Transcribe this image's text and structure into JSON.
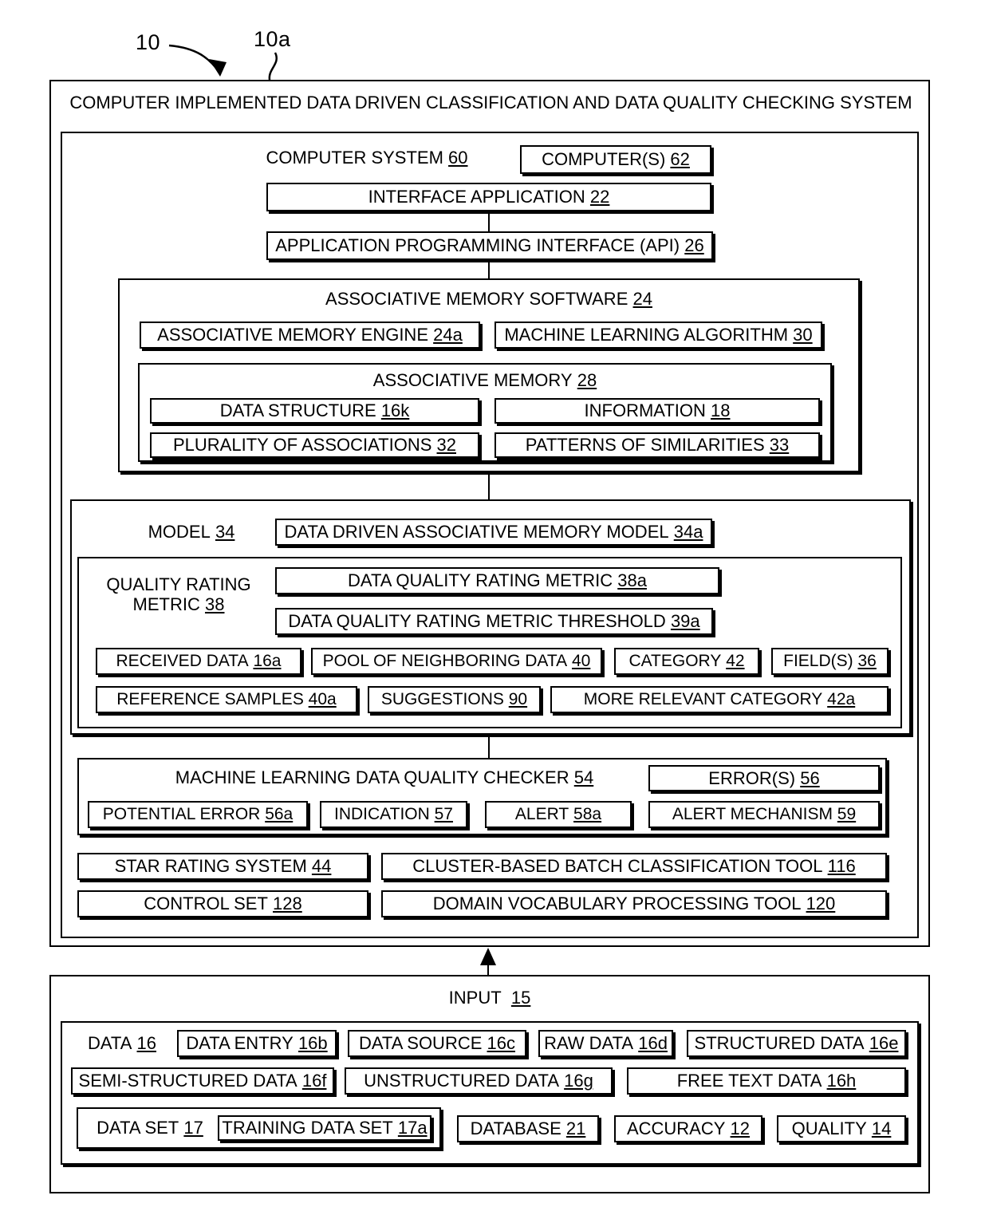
{
  "figure": {
    "lead_labels": [
      {
        "id": "lead-10",
        "text": "10"
      },
      {
        "id": "lead-10a",
        "text": "10a"
      }
    ]
  },
  "system": {
    "title": "COMPUTER IMPLEMENTED DATA DRIVEN CLASSIFICATION AND DATA QUALITY CHECKING SYSTEM",
    "computer_system": {
      "label": "COMPUTER SYSTEM",
      "ref": "60"
    },
    "computers": {
      "label": "COMPUTER(S)",
      "ref": "62"
    },
    "interface_application": {
      "label": "INTERFACE APPLICATION",
      "ref": "22"
    },
    "api": {
      "label": "APPLICATION PROGRAMMING INTERFACE (API)",
      "ref": "26"
    }
  },
  "associative_memory_software": {
    "title": {
      "label": "ASSOCIATIVE MEMORY SOFTWARE",
      "ref": "24"
    },
    "engine": {
      "label": "ASSOCIATIVE MEMORY ENGINE",
      "ref": "24a"
    },
    "ml_algorithm": {
      "label": "MACHINE LEARNING ALGORITHM",
      "ref": "30"
    },
    "associative_memory": {
      "title": {
        "label": "ASSOCIATIVE MEMORY",
        "ref": "28"
      },
      "items": [
        {
          "label": "DATA STRUCTURE",
          "ref": "16k"
        },
        {
          "label": "INFORMATION",
          "ref": "18"
        },
        {
          "label": "PLURALITY OF ASSOCIATIONS",
          "ref": "32"
        },
        {
          "label": "PATTERNS OF SIMILARITIES",
          "ref": "33"
        }
      ]
    }
  },
  "model": {
    "title": {
      "label": "MODEL",
      "ref": "34"
    },
    "data_driven_model": {
      "label": "DATA DRIVEN ASSOCIATIVE MEMORY MODEL",
      "ref": "34a"
    },
    "quality_rating_metric": {
      "label_line1": "QUALITY RATING",
      "label_line2": "METRIC",
      "ref": "38"
    },
    "metric_boxes": [
      {
        "label": "DATA QUALITY RATING METRIC",
        "ref": "38a"
      },
      {
        "label": "DATA QUALITY RATING METRIC THRESHOLD",
        "ref": "39a"
      }
    ],
    "row_a": [
      {
        "label": "RECEIVED DATA",
        "ref": "16a"
      },
      {
        "label": "POOL OF NEIGHBORING DATA",
        "ref": "40"
      },
      {
        "label": "CATEGORY",
        "ref": "42"
      },
      {
        "label": "FIELD(S)",
        "ref": "36"
      }
    ],
    "row_b": [
      {
        "label": "REFERENCE SAMPLES",
        "ref": "40a"
      },
      {
        "label": "SUGGESTIONS",
        "ref": "90"
      },
      {
        "label": "MORE RELEVANT CATEGORY",
        "ref": "42a"
      }
    ]
  },
  "quality_checker": {
    "title": {
      "label": "MACHINE LEARNING DATA QUALITY CHECKER",
      "ref": "54"
    },
    "errors": {
      "label": "ERROR(S)",
      "ref": "56"
    },
    "row": [
      {
        "label": "POTENTIAL ERROR",
        "ref": "56a"
      },
      {
        "label": "INDICATION",
        "ref": "57"
      },
      {
        "label": "ALERT",
        "ref": "58a"
      },
      {
        "label": "ALERT MECHANISM",
        "ref": "59"
      }
    ]
  },
  "tools": [
    {
      "label": "STAR RATING SYSTEM",
      "ref": "44"
    },
    {
      "label": "CLUSTER-BASED BATCH CLASSIFICATION TOOL",
      "ref": "116"
    },
    {
      "label": "CONTROL SET",
      "ref": "128"
    },
    {
      "label": "DOMAIN VOCABULARY PROCESSING TOOL",
      "ref": "120"
    }
  ],
  "input": {
    "title": {
      "label": "INPUT",
      "ref": "15"
    },
    "data": {
      "label": "DATA",
      "ref": "16"
    },
    "row1": [
      {
        "label": "DATA ENTRY",
        "ref": "16b"
      },
      {
        "label": "DATA SOURCE",
        "ref": "16c"
      },
      {
        "label": "RAW DATA",
        "ref": "16d"
      },
      {
        "label": "STRUCTURED DATA",
        "ref": "16e"
      }
    ],
    "row2": [
      {
        "label": "SEMI-STRUCTURED DATA",
        "ref": "16f"
      },
      {
        "label": "UNSTRUCTURED DATA",
        "ref": "16g"
      },
      {
        "label": "FREE TEXT DATA",
        "ref": "16h"
      }
    ],
    "data_set": {
      "label": "DATA SET",
      "ref": "17"
    },
    "training_data_set": {
      "label": "TRAINING DATA SET",
      "ref": "17a"
    },
    "row3": [
      {
        "label": "DATABASE",
        "ref": "21"
      },
      {
        "label": "ACCURACY",
        "ref": "12"
      },
      {
        "label": "QUALITY",
        "ref": "14"
      }
    ]
  }
}
